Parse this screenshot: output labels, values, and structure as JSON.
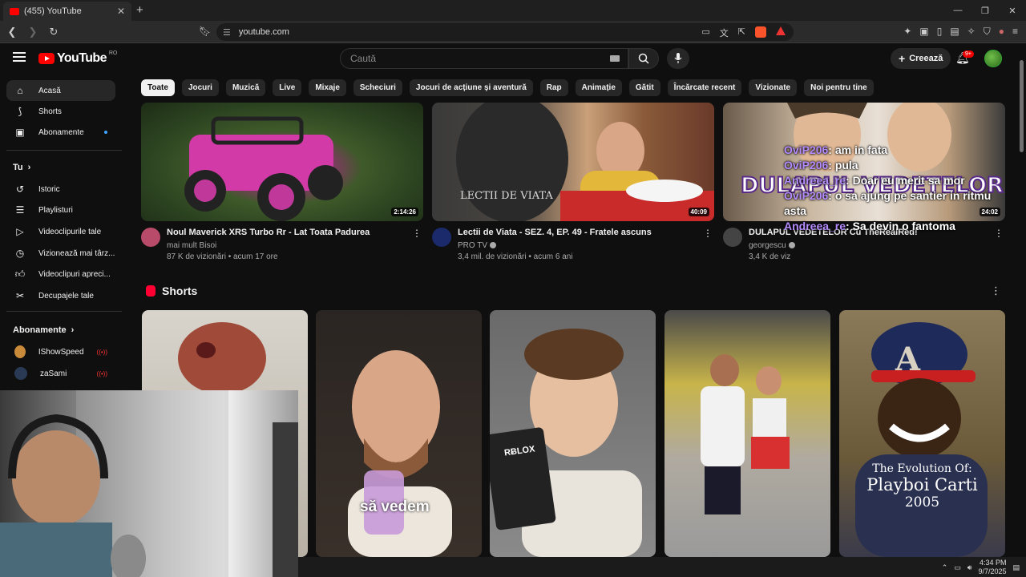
{
  "browser": {
    "tab_title": "(455) YouTube",
    "url": "youtube.com"
  },
  "header": {
    "logo_text": "YouTube",
    "region": "RO",
    "search_placeholder": "Caută",
    "create_label": "Creează",
    "notif_count": "9+"
  },
  "sidebar": {
    "main": [
      {
        "label": "Acasă",
        "icon": "home-icon"
      },
      {
        "label": "Shorts",
        "icon": "shorts-icon"
      },
      {
        "label": "Abonamente",
        "icon": "subscriptions-icon"
      }
    ],
    "you_heading": "Tu",
    "you": [
      {
        "label": "Istoric",
        "icon": "history-icon"
      },
      {
        "label": "Playlisturi",
        "icon": "playlist-icon"
      },
      {
        "label": "Videoclipurile tale",
        "icon": "your-videos-icon"
      },
      {
        "label": "Vizionează mai târz...",
        "icon": "watch-later-icon"
      },
      {
        "label": "Videoclipuri apreci...",
        "icon": "liked-icon"
      },
      {
        "label": "Decupajele tale",
        "icon": "clips-icon"
      }
    ],
    "subs_heading": "Abonamente",
    "subs": [
      {
        "label": "IShowSpeed",
        "color": "#c98a3a"
      },
      {
        "label": "zaSami",
        "color": "#2a3a55"
      }
    ]
  },
  "chips": [
    "Toate",
    "Jocuri",
    "Muzică",
    "Live",
    "Mixaje",
    "Scheciuri",
    "Jocuri de acțiune și aventură",
    "Rap",
    "Animație",
    "Gătit",
    "Încărcate recent",
    "Vizionate",
    "Noi pentru tine"
  ],
  "videos": [
    {
      "title": "Noul Maverick XRS Turbo Rr - Lat Toata Padurea",
      "channel": "mai mult Bisoi",
      "stats": "87 K de vizionări • acum 17 ore",
      "duration": "2:14:26"
    },
    {
      "title": "Lectii de Viata - SEZ. 4, EP. 49 - Fratele ascuns",
      "channel": "PRO TV",
      "stats": "3,4 mil. de vizionări • acum 6 ani",
      "duration": "40:09"
    },
    {
      "title": "DULAPUL VEDETELOR Cu TheRealRed!",
      "channel": "georgescu",
      "stats": "3,4 K de viz",
      "duration": "24:02"
    }
  ],
  "chat_overlay": [
    {
      "user": "OviP206",
      "msg": ": am in fata"
    },
    {
      "user": "OviP206",
      "msg": ": pula"
    },
    {
      "user": "Andreea_re",
      "msg": ": Doar eu merit sa mor"
    },
    {
      "user": "OviP206",
      "msg": ": o sa ajung pe santier in ritmu"
    },
    {
      "user": "",
      "msg": "asta"
    },
    {
      "user": "Andreea_re",
      "msg": ": Sa devin o fantoma"
    }
  ],
  "thumb_texts": {
    "lectii_logo": "LECTII DE VIATA",
    "dulapul": "DULAPUL VEDETELOR"
  },
  "shorts": {
    "heading": "Shorts",
    "caption_2": "să vedem",
    "caption_5_line1": "The Evolution Of:",
    "caption_5_line2": "Playboi Carti",
    "caption_5_line3": "2005",
    "roblox": "RɃLOX"
  },
  "taskbar": {
    "time": "4:34 PM",
    "date": "9/7/2025"
  }
}
